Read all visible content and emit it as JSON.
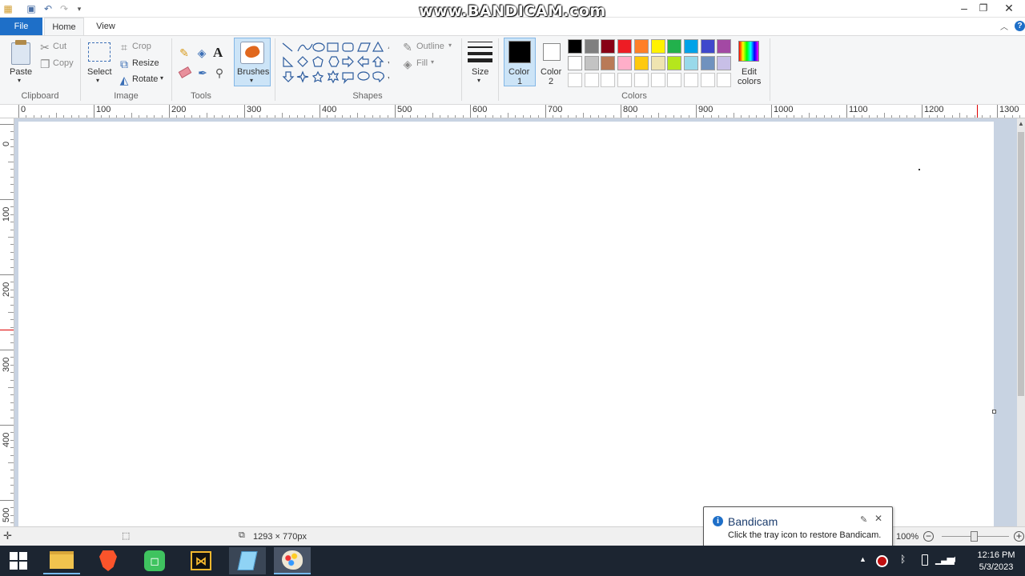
{
  "watermark": "www.BANDICAM.com",
  "tabs": {
    "file": "File",
    "home": "Home",
    "view": "View"
  },
  "clipboard": {
    "paste": "Paste",
    "cut": "Cut",
    "copy": "Copy",
    "group": "Clipboard"
  },
  "image": {
    "select": "Select",
    "crop": "Crop",
    "resize": "Resize",
    "rotate": "Rotate",
    "group": "Image"
  },
  "tools": {
    "group": "Tools"
  },
  "brushes": {
    "label": "Brushes"
  },
  "shapes": {
    "outline": "Outline",
    "fill": "Fill",
    "group": "Shapes"
  },
  "size": {
    "label": "Size"
  },
  "colors": {
    "color1": "Color",
    "color1_num": "1",
    "color2": "Color",
    "color2_num": "2",
    "edit": "Edit",
    "edit2": "colors",
    "group": "Colors",
    "palette_row1": [
      "#000000",
      "#7f7f7f",
      "#880015",
      "#ed1c24",
      "#ff7f27",
      "#fff200",
      "#22b14c",
      "#00a2e8",
      "#3f48cc",
      "#a349a4"
    ],
    "palette_row2": [
      "#ffffff",
      "#c3c3c3",
      "#b97a57",
      "#ffaec9",
      "#ffc90e",
      "#efe4b0",
      "#b5e61d",
      "#99d9ea",
      "#7092be",
      "#c8bfe7"
    ],
    "palette_row3": [
      "#ffffff",
      "#ffffff",
      "#ffffff",
      "#ffffff",
      "#ffffff",
      "#ffffff",
      "#ffffff",
      "#ffffff",
      "#ffffff",
      "#ffffff"
    ],
    "primary": "#000000",
    "secondary": "#ffffff"
  },
  "ruler": {
    "h": [
      "0",
      "100",
      "200",
      "300",
      "400",
      "500",
      "600",
      "700",
      "800",
      "900",
      "1000",
      "1100",
      "1200",
      "1300"
    ],
    "v": [
      "0",
      "100",
      "200",
      "300",
      "400",
      "500"
    ]
  },
  "status": {
    "canvas_size": "1293 × 770px",
    "zoom": "100%"
  },
  "toast": {
    "title": "Bandicam",
    "message": "Click the tray icon to restore Bandicam."
  },
  "clock": {
    "time": "12:16 PM",
    "date": "5/3/2023"
  }
}
